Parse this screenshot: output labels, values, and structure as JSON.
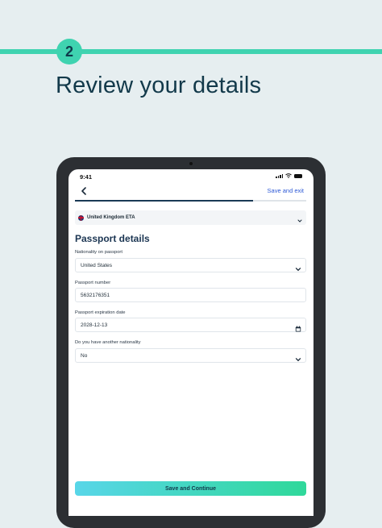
{
  "step": {
    "number": "2"
  },
  "headline": "Review your details",
  "device": {
    "status_time": "9:41"
  },
  "nav": {
    "save_exit": "Save and exit",
    "progress_fraction": 0.77
  },
  "eta": {
    "label": "United Kingdom ETA"
  },
  "form": {
    "title": "Passport details",
    "fields": [
      {
        "label": "Nationality on passport",
        "value": "United States",
        "type": "select"
      },
      {
        "label": "Passport number",
        "value": "5632176351",
        "type": "text"
      },
      {
        "label": "Passport expiration date",
        "value": "2028-12-13",
        "type": "date"
      },
      {
        "label": "Do you have another nationality",
        "value": "No",
        "type": "select"
      }
    ]
  },
  "cta": {
    "label": "Save and Continue"
  },
  "colors": {
    "accent": "#3fd3b0",
    "text_dark": "#12394a",
    "link": "#2e5ad6"
  }
}
